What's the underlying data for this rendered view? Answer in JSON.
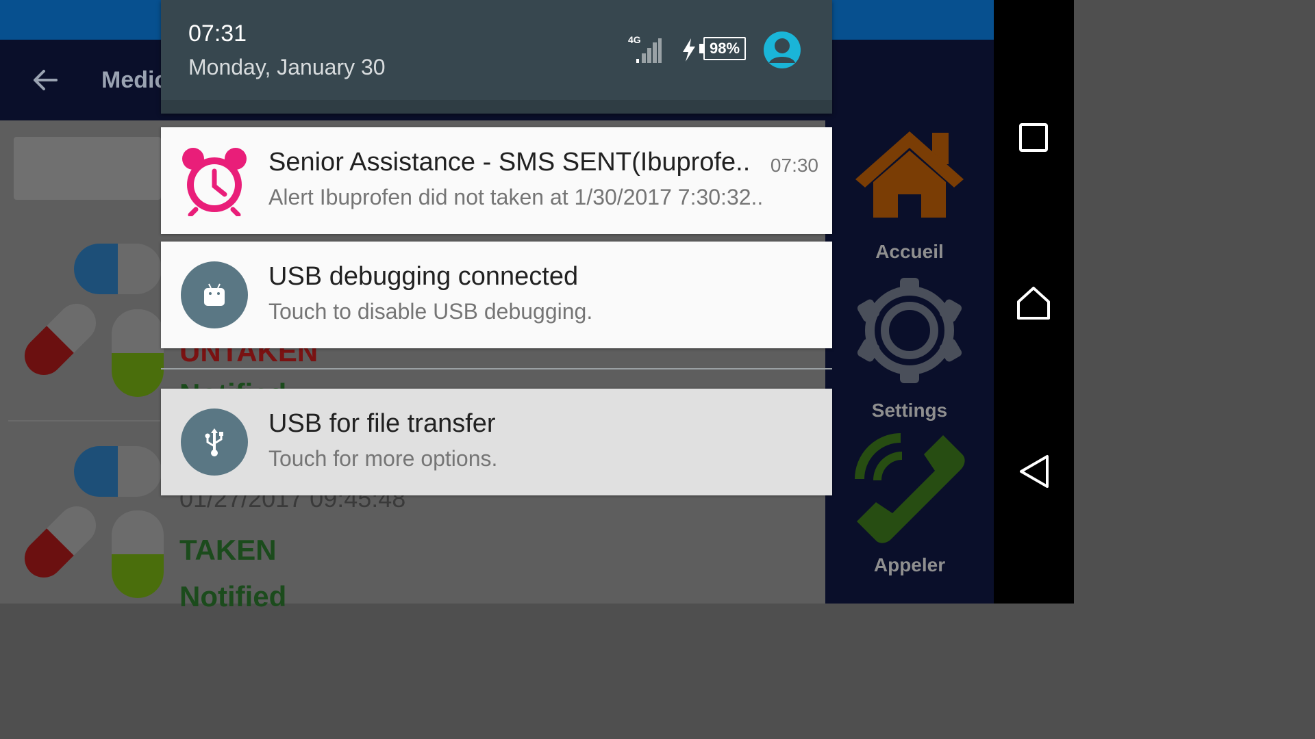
{
  "app": {
    "title": "Medic",
    "bg_labels": {
      "untaken": "UNTAKEN",
      "notified1": "Notified",
      "date_partial": "01/27/2017 09:45:48",
      "taken": "TAKEN",
      "notified2": "Notified"
    },
    "side_nav": [
      {
        "label": "Accueil",
        "icon": "home-icon"
      },
      {
        "label": "Settings",
        "icon": "gear-icon"
      },
      {
        "label": "Appeler",
        "icon": "phone-icon"
      }
    ]
  },
  "shade": {
    "time": "07:31",
    "date": "Monday, January 30",
    "network": "4G",
    "battery": "98%"
  },
  "notifications": [
    {
      "title": "Senior Assistance - SMS SENT(Ibuprofe..",
      "text": "Alert Ibuprofen  did not taken at 1/30/2017 7:30:32..",
      "time": "07:30",
      "icon": "alarm-clock-icon"
    },
    {
      "title": "USB debugging connected",
      "text": "Touch to disable USB debugging.",
      "icon": "android-debug-icon"
    },
    {
      "title": "USB for file transfer",
      "text": "Touch for more options.",
      "icon": "usb-icon"
    }
  ],
  "colors": {
    "shade_header": "#37474f",
    "alarm_pink": "#e91e79",
    "avatar": "#1ab5d8",
    "taken_green": "#1b5e20",
    "untaken_red": "#b71c1c"
  }
}
